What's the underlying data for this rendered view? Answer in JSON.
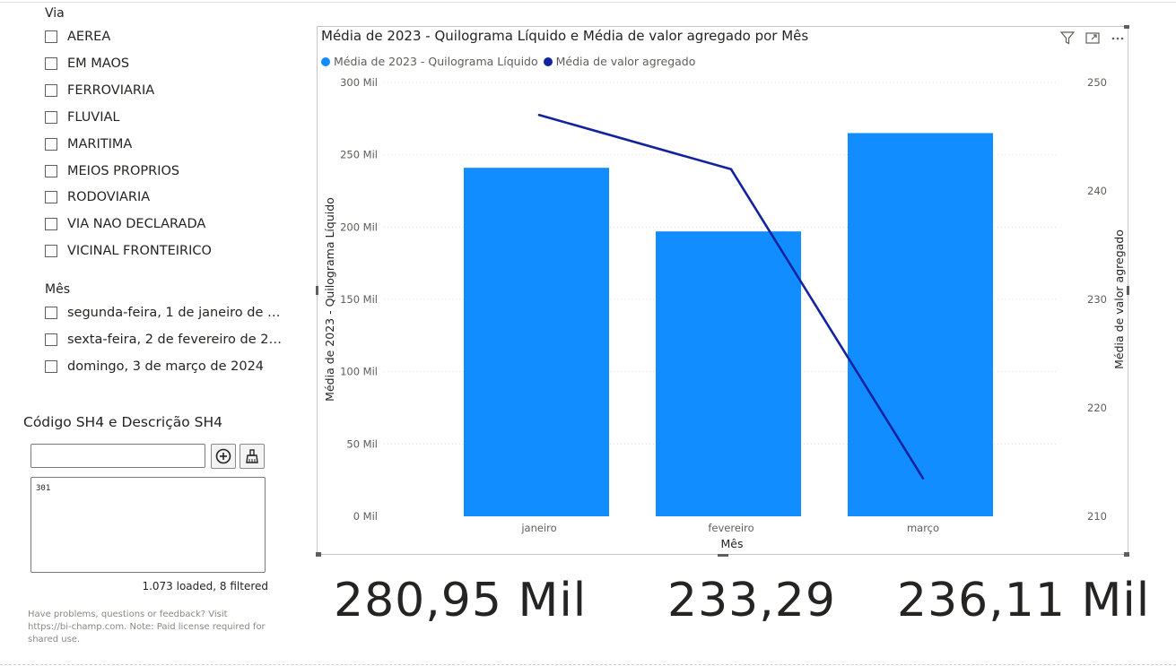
{
  "slicer_via": {
    "title": "Via",
    "items": [
      "AEREA",
      "EM MAOS",
      "FERROVIARIA",
      "FLUVIAL",
      "MARITIMA",
      "MEIOS PROPRIOS",
      "RODOVIARIA",
      "VIA NAO DECLARADA",
      "VICINAL FRONTEIRICO"
    ]
  },
  "slicer_mes": {
    "title": "Mês",
    "items": [
      "segunda-feira, 1 de janeiro de 2...",
      "sexta-feira, 2 de fevereiro de 20...",
      "domingo, 3 de março de 2024"
    ]
  },
  "sh4_filter": {
    "title": "Código SH4 e Descrição SH4",
    "input_value": "",
    "list_entries": [
      "301"
    ],
    "status": "1.073 loaded, 8 filtered",
    "note": "Have problems, questions or feedback? Visit https://bi-champ.com. Note: Paid license required for shared use.",
    "add_icon": "plus-circle-icon",
    "clear_icon": "eraser-icon"
  },
  "visual_header": {
    "icons": [
      "filter-icon",
      "focus-mode-icon",
      "more-options-icon"
    ]
  },
  "chart_data": {
    "type": "bar",
    "title": "Média de 2023 - Quilograma Líquido e Média de valor agregado por Mês",
    "categories": [
      "janeiro",
      "fevereiro",
      "março"
    ],
    "series": [
      {
        "name": "Média de 2023 - Quilograma Líquido",
        "type": "bar",
        "axis": "left",
        "color": "#118DFF",
        "values": [
          241000,
          197000,
          265000
        ]
      },
      {
        "name": "Média de valor agregado",
        "type": "line",
        "axis": "right",
        "color": "#12239E",
        "values": [
          247,
          242,
          213.5
        ]
      }
    ],
    "xlabel": "Mês",
    "ylabel": "Média de 2023 - Quilograma Líquido",
    "y2label": "Média de valor agregado",
    "ylim": [
      0,
      300000
    ],
    "y2lim": [
      210,
      250
    ],
    "yticks": [
      "0 Mil",
      "50 Mil",
      "100 Mil",
      "150 Mil",
      "200 Mil",
      "250 Mil",
      "300 Mil"
    ],
    "y2ticks": [
      "210",
      "220",
      "230",
      "240",
      "250"
    ],
    "legend_position": "top-left",
    "grid": true
  },
  "cards": [
    "280,95 Mil",
    "233,29",
    "236,11 Mil"
  ]
}
